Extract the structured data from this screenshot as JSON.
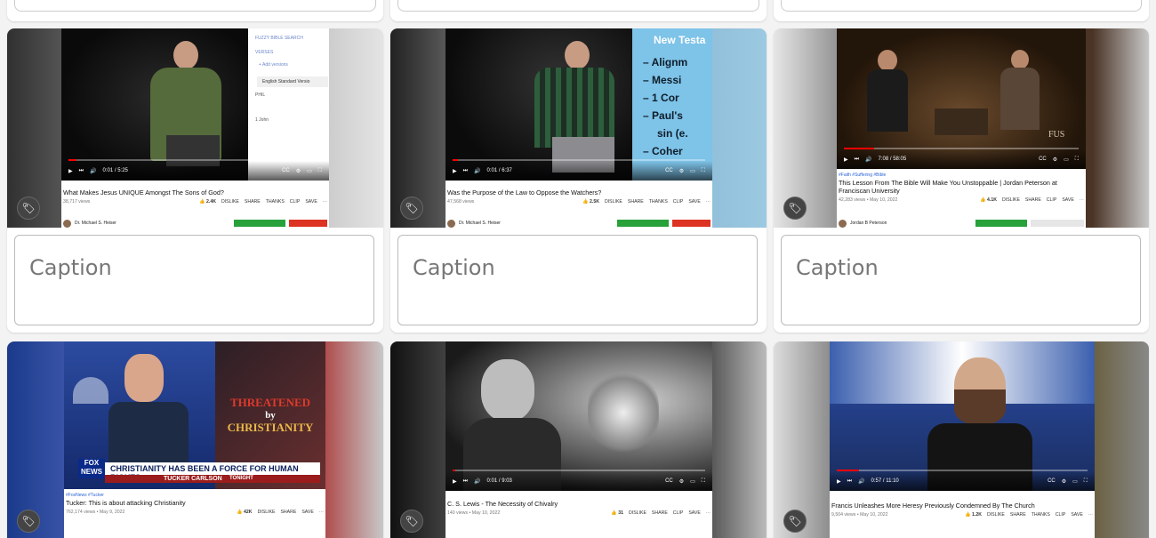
{
  "cards": [
    {
      "title": "What Makes Jesus UNIQUE Amongst The Sons of God?",
      "views": "38,717 views",
      "likes": "2.4K",
      "channel": "Dr. Michael S. Heiser",
      "time": "0:01 / 5:25",
      "caption_placeholder": "Caption",
      "sidebar_items": [
        "FUZZY BIBLE SEARCH",
        "VERSES",
        "+ Add versions",
        "English Standard Versio",
        "PHIL",
        "1 John"
      ]
    },
    {
      "title": "Was the Purpose of the Law to Oppose the Watchers?",
      "views": "47,568 views",
      "likes": "2.5K",
      "channel": "Dr. Michael S. Heiser",
      "time": "0:01 / 6:37",
      "caption_placeholder": "Caption",
      "slide_title": "New Testa",
      "slide_bullets": [
        "Alignm",
        "Messi",
        "1 Cor",
        "Paul's",
        "sin (e.",
        "Coher"
      ]
    },
    {
      "tags": "#Faith #Suffering #Bible",
      "title": "This Lesson From The Bible Will Make You Unstoppable | Jordan Peterson at Franciscan University",
      "views": "42,283 views • May 10, 2022",
      "likes": "4.1K",
      "channel": "Jordan B Peterson",
      "time": "7:08 / 58:05",
      "caption_placeholder": "Caption",
      "logo": "FUS"
    },
    {
      "tags": "#FoxNews #Tucker",
      "title": "Tucker: This is about attacking Christianity",
      "views": "762,174 views • May 9, 2022",
      "likes": "42K",
      "chyron": "CHRISTIANITY HAS BEEN A FORCE FOR HUMAN RIGHTS",
      "show": "TUCKER CARLSON",
      "show_tag": "TONIGHT",
      "overlay_line1": "THREATENED",
      "overlay_line2": "by",
      "overlay_line3": "CHRISTIANITY",
      "fox_line1": "FOX",
      "fox_line2": "NEWS"
    },
    {
      "title": "C. S. Lewis - The Necessity of Chivalry",
      "views": "140 views • May 10, 2022",
      "likes": "31",
      "time": "0:01 / 9:03"
    },
    {
      "title": "Francis Unleashes More Heresy Previously Condemned By The Church",
      "views": "9,504 views • May 10, 2022",
      "likes": "1.2K",
      "time": "0:57 / 11:10"
    }
  ],
  "actions": {
    "dislike": "DISLIKE",
    "share": "SHARE",
    "thanks": "THANKS",
    "clip": "CLIP",
    "save": "SAVE"
  },
  "icons": {
    "tag": "tag-icon",
    "play": "play-icon",
    "next": "next-icon",
    "volume": "volume-icon"
  }
}
